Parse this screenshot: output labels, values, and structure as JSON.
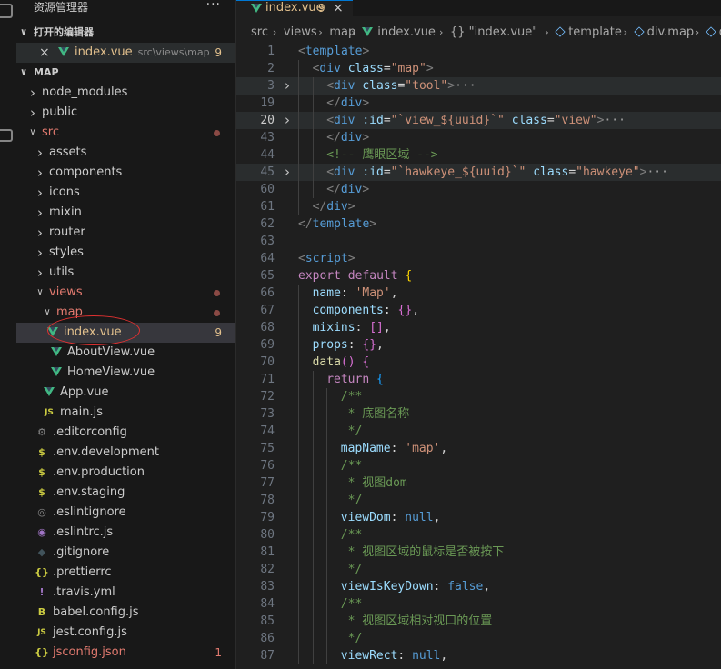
{
  "activity_bar": {
    "icons": [
      "explorer-icon",
      "source-control-icon"
    ]
  },
  "sidebar": {
    "title": "资源管理器",
    "more": "···",
    "open_editors_header": "打开的编辑器",
    "open_editor": {
      "name": "index.vue",
      "path": "src\\views\\map",
      "badge": "9"
    },
    "project_header": "MAP",
    "tree": [
      {
        "name": "node_modules",
        "type": "folder",
        "depth": 1,
        "expanded": false
      },
      {
        "name": "public",
        "type": "folder",
        "depth": 1,
        "expanded": false
      },
      {
        "name": "src",
        "type": "folder",
        "depth": 1,
        "expanded": true,
        "color": "red",
        "dot": true
      },
      {
        "name": "assets",
        "type": "folder",
        "depth": 2,
        "expanded": false
      },
      {
        "name": "components",
        "type": "folder",
        "depth": 2,
        "expanded": false
      },
      {
        "name": "icons",
        "type": "folder",
        "depth": 2,
        "expanded": false
      },
      {
        "name": "mixin",
        "type": "folder",
        "depth": 2,
        "expanded": false
      },
      {
        "name": "router",
        "type": "folder",
        "depth": 2,
        "expanded": false
      },
      {
        "name": "styles",
        "type": "folder",
        "depth": 2,
        "expanded": false
      },
      {
        "name": "utils",
        "type": "folder",
        "depth": 2,
        "expanded": false
      },
      {
        "name": "views",
        "type": "folder",
        "depth": 2,
        "expanded": true,
        "color": "red",
        "dot": true
      },
      {
        "name": "map",
        "type": "folder",
        "depth": 3,
        "expanded": true,
        "color": "red",
        "dot": true
      },
      {
        "name": "index.vue",
        "type": "vue",
        "depth": 4,
        "color": "yellow",
        "badge": "9",
        "selected": true
      },
      {
        "name": "AboutView.vue",
        "type": "vue",
        "depth": 3
      },
      {
        "name": "HomeView.vue",
        "type": "vue",
        "depth": 3
      },
      {
        "name": "App.vue",
        "type": "vue",
        "depth": 2
      },
      {
        "name": "main.js",
        "type": "js",
        "depth": 2
      },
      {
        "name": ".editorconfig",
        "type": "gear",
        "depth": 1
      },
      {
        "name": ".env.development",
        "type": "dollar",
        "depth": 1
      },
      {
        "name": ".env.production",
        "type": "dollar",
        "depth": 1
      },
      {
        "name": ".env.staging",
        "type": "dollar",
        "depth": 1
      },
      {
        "name": ".eslintignore",
        "type": "eslint",
        "depth": 1
      },
      {
        "name": ".eslintrc.js",
        "type": "eslintjs",
        "depth": 1
      },
      {
        "name": ".gitignore",
        "type": "git",
        "depth": 1
      },
      {
        "name": ".prettierrc",
        "type": "json",
        "depth": 1
      },
      {
        "name": ".travis.yml",
        "type": "yml",
        "depth": 1
      },
      {
        "name": "babel.config.js",
        "type": "babel",
        "depth": 1
      },
      {
        "name": "jest.config.js",
        "type": "js",
        "depth": 1
      },
      {
        "name": "jsconfig.json",
        "type": "json",
        "depth": 1,
        "color": "red",
        "badge": "1"
      }
    ]
  },
  "tab": {
    "label": "index.vue",
    "count": "9",
    "close": "×"
  },
  "breadcrumbs": [
    "src",
    "views",
    "map",
    "index.vue",
    "{} \"index.vue\"",
    "template",
    "div.map",
    "div."
  ],
  "code_lines": [
    {
      "n": "1",
      "tokens": [
        [
          "t-punc",
          "<"
        ],
        [
          "t-tag",
          "template"
        ],
        [
          "t-punc",
          ">"
        ]
      ],
      "indent": 0
    },
    {
      "n": "2",
      "tokens": [
        [
          "t-punc",
          "<"
        ],
        [
          "t-tag",
          "div"
        ],
        [
          "t-def",
          " "
        ],
        [
          "t-attr",
          "class"
        ],
        [
          "t-def",
          "="
        ],
        [
          "t-str",
          "\"map\""
        ],
        [
          "t-punc",
          ">"
        ]
      ],
      "indent": 1
    },
    {
      "n": "3",
      "fold": true,
      "hl": true,
      "tokens": [
        [
          "t-punc",
          "<"
        ],
        [
          "t-tag",
          "div"
        ],
        [
          "t-def",
          " "
        ],
        [
          "t-attr",
          "class"
        ],
        [
          "t-def",
          "="
        ],
        [
          "t-str",
          "\"tool\""
        ],
        [
          "t-punc",
          ">"
        ],
        [
          "t-ell",
          "···"
        ]
      ],
      "indent": 2
    },
    {
      "n": "19",
      "tokens": [
        [
          "t-punc",
          "</"
        ],
        [
          "t-tag",
          "div"
        ],
        [
          "t-punc",
          ">"
        ]
      ],
      "indent": 2
    },
    {
      "n": "20",
      "fold": true,
      "hl": true,
      "cur": true,
      "tokens": [
        [
          "t-punc",
          "<"
        ],
        [
          "t-tag",
          "div"
        ],
        [
          "t-def",
          " "
        ],
        [
          "t-attr",
          ":id"
        ],
        [
          "t-def",
          "="
        ],
        [
          "t-str",
          "\"`view_${uuid}`\""
        ],
        [
          "t-def",
          " "
        ],
        [
          "t-attr",
          "class"
        ],
        [
          "t-def",
          "="
        ],
        [
          "t-str",
          "\"view\""
        ],
        [
          "t-punc",
          ">"
        ],
        [
          "t-ell",
          "···"
        ]
      ],
      "indent": 2
    },
    {
      "n": "43",
      "tokens": [
        [
          "t-punc",
          "</"
        ],
        [
          "t-tag",
          "div"
        ],
        [
          "t-punc",
          ">"
        ]
      ],
      "indent": 2
    },
    {
      "n": "44",
      "tokens": [
        [
          "t-com",
          "<!-- 鹰眼区域 -->"
        ]
      ],
      "indent": 2
    },
    {
      "n": "45",
      "fold": true,
      "hl": true,
      "tokens": [
        [
          "t-punc",
          "<"
        ],
        [
          "t-tag",
          "div"
        ],
        [
          "t-def",
          " "
        ],
        [
          "t-attr",
          ":id"
        ],
        [
          "t-def",
          "="
        ],
        [
          "t-str",
          "\"`hawkeye_${uuid}`\""
        ],
        [
          "t-def",
          " "
        ],
        [
          "t-attr",
          "class"
        ],
        [
          "t-def",
          "="
        ],
        [
          "t-str",
          "\"hawkeye\""
        ],
        [
          "t-punc",
          ">"
        ],
        [
          "t-ell",
          "···"
        ]
      ],
      "indent": 2
    },
    {
      "n": "60",
      "tokens": [
        [
          "t-punc",
          "</"
        ],
        [
          "t-tag",
          "div"
        ],
        [
          "t-punc",
          ">"
        ]
      ],
      "indent": 2
    },
    {
      "n": "61",
      "tokens": [
        [
          "t-punc",
          "</"
        ],
        [
          "t-tag",
          "div"
        ],
        [
          "t-punc",
          ">"
        ]
      ],
      "indent": 1
    },
    {
      "n": "62",
      "tokens": [
        [
          "t-punc",
          "</"
        ],
        [
          "t-tag",
          "template"
        ],
        [
          "t-punc",
          ">"
        ]
      ],
      "indent": 0
    },
    {
      "n": "63",
      "tokens": [],
      "indent": 0
    },
    {
      "n": "64",
      "tokens": [
        [
          "t-punc",
          "<"
        ],
        [
          "t-tag",
          "script"
        ],
        [
          "t-punc",
          ">"
        ]
      ],
      "indent": 0
    },
    {
      "n": "65",
      "tokens": [
        [
          "t-ctl",
          "export"
        ],
        [
          "t-def",
          " "
        ],
        [
          "t-ctl",
          "default"
        ],
        [
          "t-def",
          " "
        ],
        [
          "t-brace1",
          "{"
        ]
      ],
      "indent": 0
    },
    {
      "n": "66",
      "tokens": [
        [
          "t-prop",
          "name"
        ],
        [
          "t-def",
          ": "
        ],
        [
          "t-str",
          "'Map'"
        ],
        [
          "t-def",
          ","
        ]
      ],
      "indent": 1
    },
    {
      "n": "67",
      "tokens": [
        [
          "t-prop",
          "components"
        ],
        [
          "t-def",
          ": "
        ],
        [
          "t-brace2",
          "{}"
        ],
        [
          "t-def",
          ","
        ]
      ],
      "indent": 1
    },
    {
      "n": "68",
      "tokens": [
        [
          "t-prop",
          "mixins"
        ],
        [
          "t-def",
          ": "
        ],
        [
          "t-brace2",
          "[]"
        ],
        [
          "t-def",
          ","
        ]
      ],
      "indent": 1
    },
    {
      "n": "69",
      "tokens": [
        [
          "t-prop",
          "props"
        ],
        [
          "t-def",
          ": "
        ],
        [
          "t-brace2",
          "{}"
        ],
        [
          "t-def",
          ","
        ]
      ],
      "indent": 1
    },
    {
      "n": "70",
      "tokens": [
        [
          "t-fn",
          "data"
        ],
        [
          "t-brace2",
          "()"
        ],
        [
          "t-def",
          " "
        ],
        [
          "t-brace2",
          "{"
        ]
      ],
      "indent": 1
    },
    {
      "n": "71",
      "tokens": [
        [
          "t-ctl",
          "return"
        ],
        [
          "t-def",
          " "
        ],
        [
          "t-brace3",
          "{"
        ]
      ],
      "indent": 2
    },
    {
      "n": "72",
      "tokens": [
        [
          "t-com",
          "/**"
        ]
      ],
      "indent": 3
    },
    {
      "n": "73",
      "tokens": [
        [
          "t-com",
          " * 底图名称"
        ]
      ],
      "indent": 3
    },
    {
      "n": "74",
      "tokens": [
        [
          "t-com",
          " */"
        ]
      ],
      "indent": 3
    },
    {
      "n": "75",
      "tokens": [
        [
          "t-prop",
          "mapName"
        ],
        [
          "t-def",
          ": "
        ],
        [
          "t-str",
          "'map'"
        ],
        [
          "t-def",
          ","
        ]
      ],
      "indent": 3
    },
    {
      "n": "76",
      "tokens": [
        [
          "t-com",
          "/**"
        ]
      ],
      "indent": 3
    },
    {
      "n": "77",
      "tokens": [
        [
          "t-com",
          " * 视图dom"
        ]
      ],
      "indent": 3
    },
    {
      "n": "78",
      "tokens": [
        [
          "t-com",
          " */"
        ]
      ],
      "indent": 3
    },
    {
      "n": "79",
      "tokens": [
        [
          "t-prop",
          "viewDom"
        ],
        [
          "t-def",
          ": "
        ],
        [
          "t-kw",
          "null"
        ],
        [
          "t-def",
          ","
        ]
      ],
      "indent": 3
    },
    {
      "n": "80",
      "tokens": [
        [
          "t-com",
          "/**"
        ]
      ],
      "indent": 3
    },
    {
      "n": "81",
      "tokens": [
        [
          "t-com",
          " * 视图区域的鼠标是否被按下"
        ]
      ],
      "indent": 3
    },
    {
      "n": "82",
      "tokens": [
        [
          "t-com",
          " */"
        ]
      ],
      "indent": 3
    },
    {
      "n": "83",
      "tokens": [
        [
          "t-prop",
          "viewIsKeyDown"
        ],
        [
          "t-def",
          ": "
        ],
        [
          "t-kw",
          "false"
        ],
        [
          "t-def",
          ","
        ]
      ],
      "indent": 3
    },
    {
      "n": "84",
      "tokens": [
        [
          "t-com",
          "/**"
        ]
      ],
      "indent": 3
    },
    {
      "n": "85",
      "tokens": [
        [
          "t-com",
          " * 视图区域相对视口的位置"
        ]
      ],
      "indent": 3
    },
    {
      "n": "86",
      "tokens": [
        [
          "t-com",
          " */"
        ]
      ],
      "indent": 3
    },
    {
      "n": "87",
      "tokens": [
        [
          "t-prop",
          "viewRect"
        ],
        [
          "t-def",
          ": "
        ],
        [
          "t-kw",
          "null"
        ],
        [
          "t-def",
          ","
        ]
      ],
      "indent": 3
    }
  ]
}
